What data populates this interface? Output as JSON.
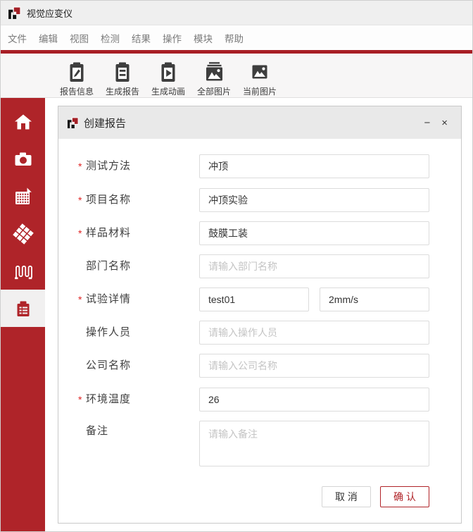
{
  "window": {
    "title": "视觉应变仪"
  },
  "menu": {
    "items": [
      "文件",
      "编辑",
      "视图",
      "检测",
      "结果",
      "操作",
      "模块",
      "帮助"
    ]
  },
  "toolbar": {
    "buttons": [
      {
        "label": "报告信息",
        "icon": "report-info-icon"
      },
      {
        "label": "生成报告",
        "icon": "generate-report-icon"
      },
      {
        "label": "生成动画",
        "icon": "generate-animation-icon"
      },
      {
        "label": "全部图片",
        "icon": "all-images-icon"
      },
      {
        "label": "当前图片",
        "icon": "current-image-icon"
      }
    ]
  },
  "sidebar": {
    "items": [
      {
        "icon": "home-icon",
        "selected": false
      },
      {
        "icon": "camera-icon",
        "selected": false
      },
      {
        "icon": "grid-dots-icon",
        "selected": false
      },
      {
        "icon": "mesh-icon",
        "selected": false
      },
      {
        "icon": "coil-icon",
        "selected": false
      },
      {
        "icon": "report-clipboard-icon",
        "selected": true
      }
    ]
  },
  "dialog": {
    "title": "创建报告",
    "minimize_glyph": "−",
    "close_glyph": "×",
    "required_marker": "*",
    "fields": [
      {
        "label": "测试方法",
        "required": true,
        "value": "冲顶"
      },
      {
        "label": "项目名称",
        "required": true,
        "value": "冲顶实验"
      },
      {
        "label": "样品材料",
        "required": true,
        "value": "鼓膜工装"
      },
      {
        "label": "部门名称",
        "required": false,
        "placeholder": "请输入部门名称"
      },
      {
        "label": "试验详情",
        "required": true,
        "value": "test01",
        "value2": "2mm/s"
      },
      {
        "label": "操作人员",
        "required": false,
        "placeholder": "请输入操作人员"
      },
      {
        "label": "公司名称",
        "required": false,
        "placeholder": "请输入公司名称"
      },
      {
        "label": "环境温度",
        "required": true,
        "value": "26"
      },
      {
        "label": "备注",
        "required": false,
        "placeholder": "请输入备注"
      }
    ],
    "buttons": {
      "cancel": "取 消",
      "confirm": "确 认"
    }
  },
  "colors": {
    "sidebar_red": "#af2429",
    "divider_red": "#a81e25",
    "confirm_red": "#b02328",
    "required_red": "#e02424",
    "logo_black": "#141414",
    "logo_red": "#a32026"
  }
}
